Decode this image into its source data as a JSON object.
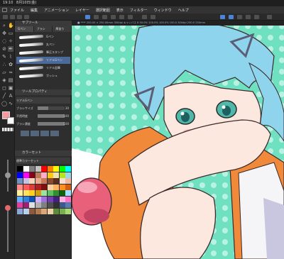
{
  "system": {
    "time": "19:10",
    "date": "8月10日(金)",
    "device_icon": "wifi-icon"
  },
  "menu": [
    "ファイル",
    "編集",
    "アニメーション",
    "レイヤー",
    "選択範囲",
    "表示",
    "フィルター",
    "ウィンドウ",
    "ヘルプ"
  ],
  "canvas_tab": "■ **** 250.00 × 250.00mm 350dpi キャンバス 8 50.0% 100.0% 100.0% 100.0 300dpi 250.0 250mm",
  "subtool": {
    "title": "サブツール",
    "tabs": [
      "Gペン",
      "ブラシ",
      "厚塗り"
    ],
    "brushes": [
      {
        "name": "Gペン"
      },
      {
        "name": "丸ペン"
      },
      {
        "name": "筆圧スタンプ"
      },
      {
        "name": "リアルGペン"
      },
      {
        "name": "リアル鉛筆"
      },
      {
        "name": "ガッシュ"
      }
    ],
    "property_title": "ツールプロパティ",
    "properties": [
      {
        "label": "ブラシサイズ",
        "value": "30"
      },
      {
        "label": "不透明度",
        "value": "100"
      },
      {
        "label": "ブラシ濃度",
        "value": "100"
      }
    ]
  },
  "colorset": {
    "title": "カラーセット",
    "set_name": "標準カラーセット",
    "colors": [
      "#000000",
      "#ffffff",
      "#7f7f7f",
      "#c3c3c3",
      "#ff0000",
      "#ff8000",
      "#ffff00",
      "#00ff00",
      "#00ffff",
      "#0000ff",
      "#ff00ff",
      "#880015",
      "#b97a57",
      "#ffaec9",
      "#ffc90e",
      "#efe4b0",
      "#b5e61d",
      "#99d9ea",
      "#7092be",
      "#c8bfe7",
      "#f3d4bd",
      "#e9a88b",
      "#c77b58",
      "#8c4a2f",
      "#5a2d1a",
      "#f8e0d0",
      "#f0b8a0",
      "#ff8c8c",
      "#ff5a5a",
      "#e03a3a",
      "#b02020",
      "#801010",
      "#ffd0a0",
      "#ffb060",
      "#ff9020",
      "#d06010",
      "#fff0a0",
      "#ffe060",
      "#ffd020",
      "#d0a010",
      "#a0e0a0",
      "#60c060",
      "#309030",
      "#106010",
      "#a0e0ff",
      "#60b0ff",
      "#3080e0",
      "#1050b0",
      "#d0b0ff",
      "#a070e0",
      "#7040b0",
      "#402080",
      "#ffb0e0",
      "#ff70c0",
      "#e040a0",
      "#a02070",
      "#e0e0e0",
      "#b0b0b0",
      "#808080",
      "#505050",
      "#303030",
      "#3c5a8c",
      "#5a7ab0",
      "#8aa8d8",
      "#b8d0f0",
      "#8c5a3c",
      "#b07a50",
      "#d8a878",
      "#f0d0a8",
      "#5a8c3c",
      "#7ab050",
      "#a8d878"
    ]
  },
  "colors": {
    "main": "#f39a9e",
    "sub": "#ffffff",
    "accent": "#4c84d8",
    "canvas_bg": "#6fe0c0",
    "hair": "#8ed4ec",
    "orange": "#f08a3a",
    "skin": "#fde8e0"
  }
}
